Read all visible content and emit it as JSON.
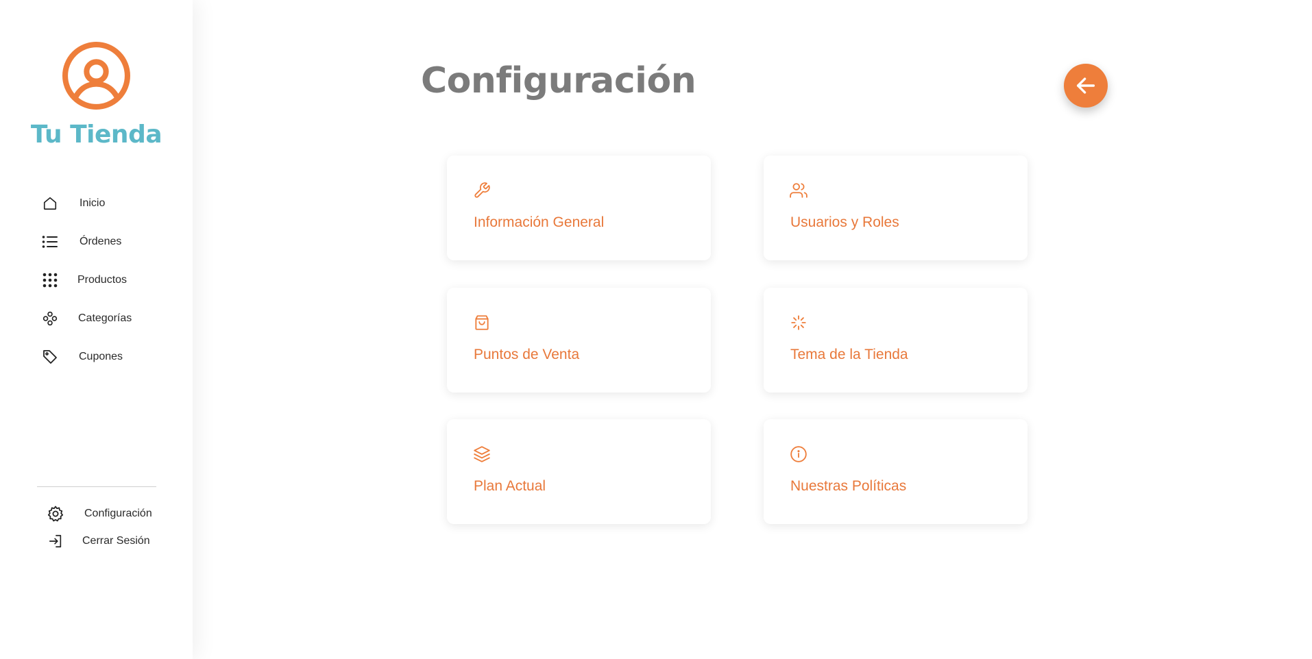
{
  "brand": {
    "name": "Tu Tienda",
    "logo_icon": "user-circle-icon",
    "logo_color": "#ee7e3b",
    "name_color": "#5cb8c8"
  },
  "sidebar": {
    "items": [
      {
        "label": "Inicio",
        "icon": "home-icon"
      },
      {
        "label": "Órdenes",
        "icon": "list-icon"
      },
      {
        "label": "Productos",
        "icon": "grid-icon"
      },
      {
        "label": "Categorías",
        "icon": "categories-icon"
      },
      {
        "label": "Cupones",
        "icon": "tag-icon"
      }
    ],
    "bottom": [
      {
        "label": "Configuración",
        "icon": "gear-icon"
      },
      {
        "label": "Cerrar Sesión",
        "icon": "logout-icon"
      }
    ]
  },
  "header": {
    "title": "Configuración",
    "back_icon": "arrow-left-icon"
  },
  "cards": [
    {
      "label": "Información General",
      "icon": "wrench-icon"
    },
    {
      "label": "Usuarios y Roles",
      "icon": "users-icon"
    },
    {
      "label": "Puntos de Venta",
      "icon": "shopping-bag-icon"
    },
    {
      "label": "Tema de la Tienda",
      "icon": "loader-icon"
    },
    {
      "label": "Plan Actual",
      "icon": "layers-icon"
    },
    {
      "label": "Nuestras Políticas",
      "icon": "info-icon"
    }
  ],
  "colors": {
    "accent": "#ee7e3b",
    "card_text": "#e8783a",
    "title": "#7b7b7b"
  }
}
